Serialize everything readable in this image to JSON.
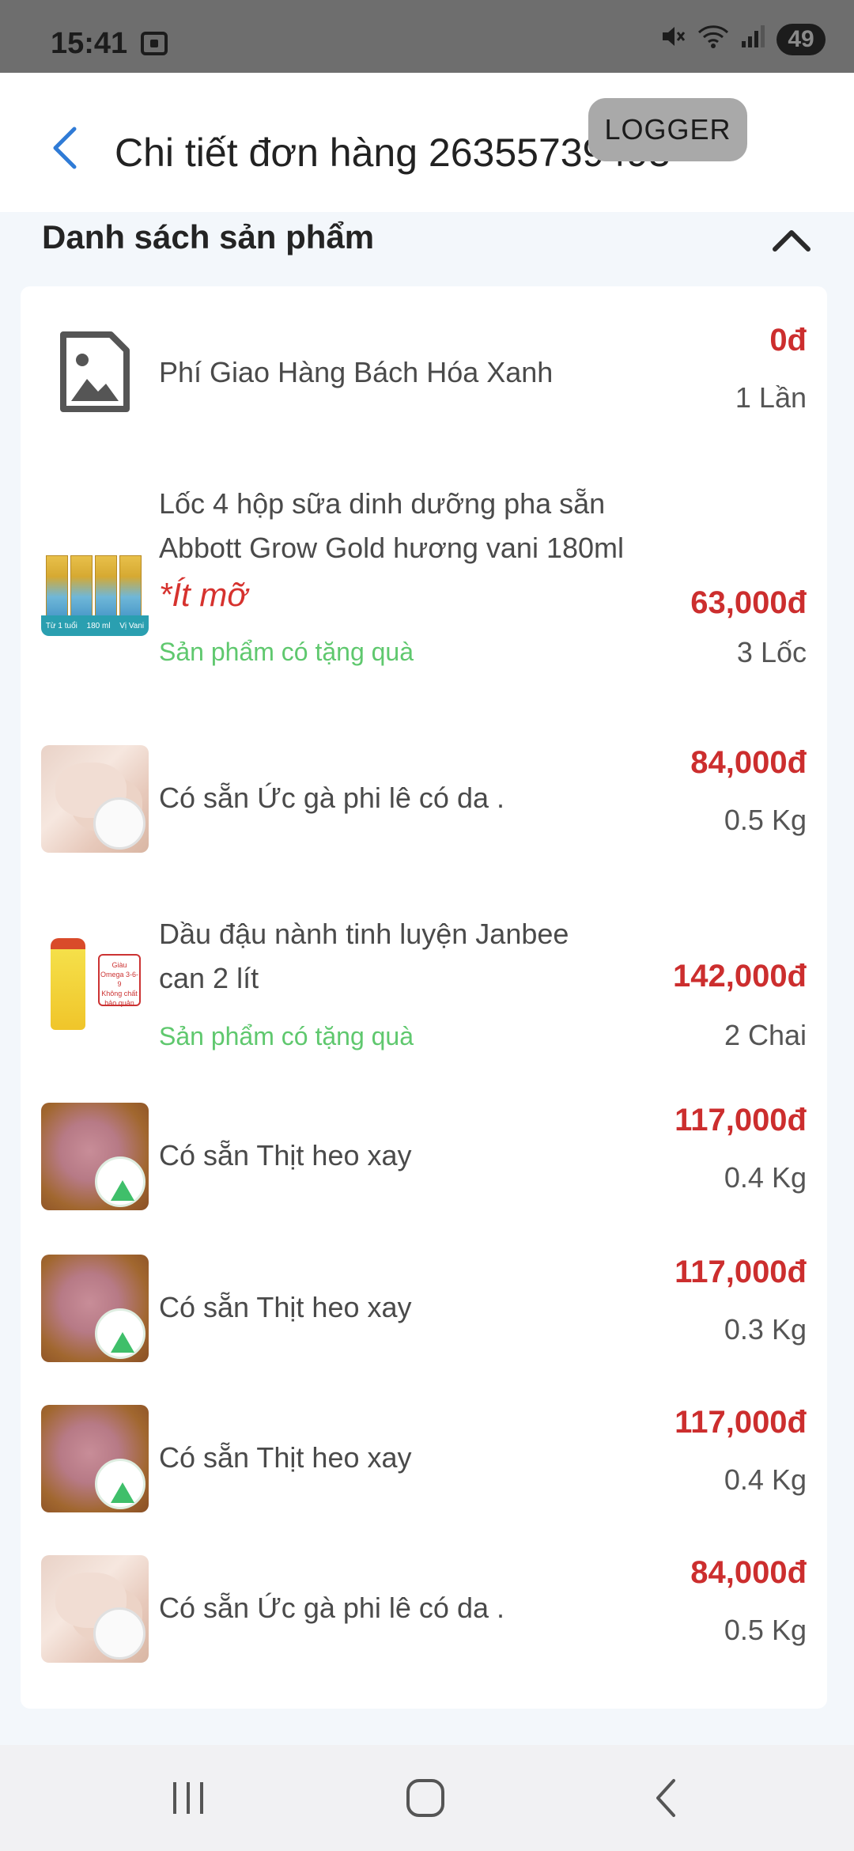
{
  "status_bar": {
    "time": "15:41",
    "battery": "49",
    "icons": [
      "screenshot-icon",
      "mute-icon",
      "wifi-icon",
      "signal-icon"
    ]
  },
  "header": {
    "title": "Chi tiết đơn hàng 26355739493",
    "back_icon": "chevron-left-icon",
    "logger_label": "LOGGER"
  },
  "section": {
    "title": "Danh sách sản phẩm",
    "collapse_icon": "chevron-up-icon"
  },
  "products": [
    {
      "name": "Phí Giao Hàng Bách Hóa Xanh",
      "price": "0đ",
      "quantity": "1 Lần",
      "image": "image-placeholder-icon"
    },
    {
      "name_line1": "Lốc 4 hộp sữa dinh dưỡng pha sẵn",
      "name_line2": "Abbott Grow Gold hương vani 180ml",
      "note": "*Ít mỡ",
      "promo": "Sản phẩm có tặng quà",
      "price": "63,000đ",
      "quantity": "3 Lốc",
      "image": "milk-pack-image",
      "image_text": [
        "Từ 1 tuổi",
        "180 ml",
        "Vị Vani"
      ]
    },
    {
      "name": "Có sẵn Ức gà phi lê có da .",
      "price": "84,000đ",
      "quantity": "0.5 Kg",
      "image": "chicken-breast-image"
    },
    {
      "name_line1": "Dầu đậu nành tinh luyện Janbee",
      "name_line2": "can 2 lít",
      "promo": "Sản phẩm có tặng quà",
      "price": "142,000đ",
      "quantity": "2 Chai",
      "image": "soybean-oil-image",
      "image_text": [
        "Giàu Omega 3-6-9",
        "Không chất bảo quản"
      ]
    },
    {
      "name": "Có sẵn Thịt heo xay",
      "price": "117,000đ",
      "quantity": "0.4 Kg",
      "image": "minced-pork-image"
    },
    {
      "name": "Có sẵn Thịt heo xay",
      "price": "117,000đ",
      "quantity": "0.3 Kg",
      "image": "minced-pork-image"
    },
    {
      "name": "Có sẵn Thịt heo xay",
      "price": "117,000đ",
      "quantity": "0.4 Kg",
      "image": "minced-pork-image"
    },
    {
      "name": "Có sẵn Ức gà phi lê có da .",
      "price": "84,000đ",
      "quantity": "0.5 Kg",
      "image": "chicken-breast-image"
    }
  ],
  "nav_bar": {
    "icons": [
      "recent-apps-icon",
      "home-icon",
      "back-icon"
    ]
  },
  "colors": {
    "price": "#cc2e2e",
    "promo": "#5fc86e",
    "accent": "#2f7bd6",
    "logger_bg": "#a9a9a9"
  }
}
